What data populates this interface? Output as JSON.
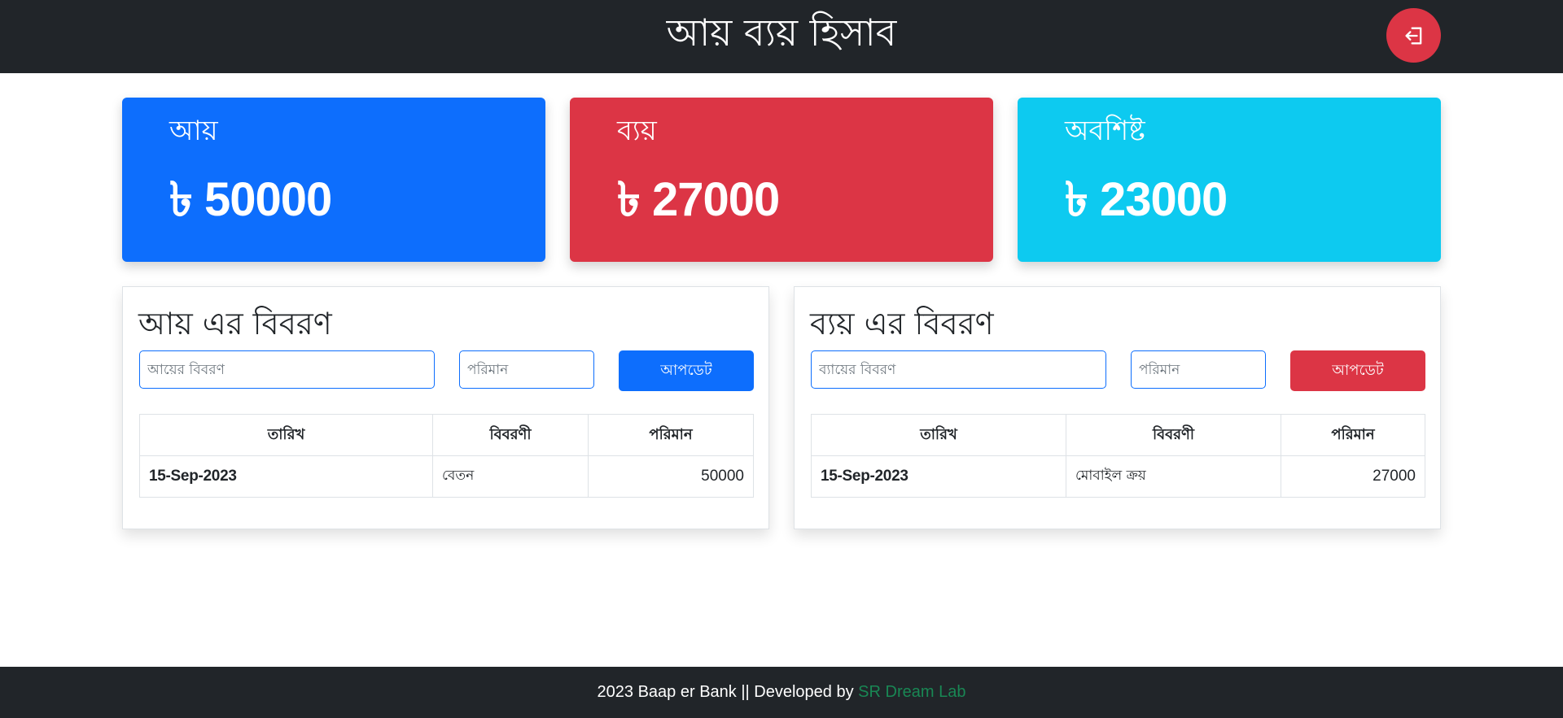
{
  "header": {
    "title": "আয় ব্যয় হিসাব",
    "logout_icon": "logout-icon"
  },
  "colors": {
    "income": "#0d6efd",
    "expense": "#dc3545",
    "balance": "#0dcaf0",
    "dark": "#212529",
    "link": "#198754"
  },
  "summary": {
    "currency": "৳",
    "income": {
      "label": "আয়",
      "amount": "50000"
    },
    "expense": {
      "label": "ব্যয়",
      "amount": "27000"
    },
    "balance": {
      "label": "অবশিষ্ট",
      "amount": "23000"
    }
  },
  "income_panel": {
    "title": "আয় এর বিবরণ",
    "desc_placeholder": "আয়ের বিবরণ",
    "amount_placeholder": "পরিমান",
    "update_label": "আপডেট",
    "columns": [
      "তারিখ",
      "বিবরণী",
      "পরিমান"
    ],
    "rows": [
      {
        "date": "15-Sep-2023",
        "description": "বেতন",
        "amount": "50000"
      }
    ]
  },
  "expense_panel": {
    "title": "ব্যয় এর বিবরণ",
    "desc_placeholder": "ব্যায়ের বিবরণ",
    "amount_placeholder": "পরিমান",
    "update_label": "আপডেট",
    "columns": [
      "তারিখ",
      "বিবরণী",
      "পরিমান"
    ],
    "rows": [
      {
        "date": "15-Sep-2023",
        "description": "মোবাইল ক্রয়",
        "amount": "27000"
      }
    ]
  },
  "footer": {
    "text": "2023 Baap er Bank || Developed by",
    "link_text": "SR Dream Lab"
  }
}
